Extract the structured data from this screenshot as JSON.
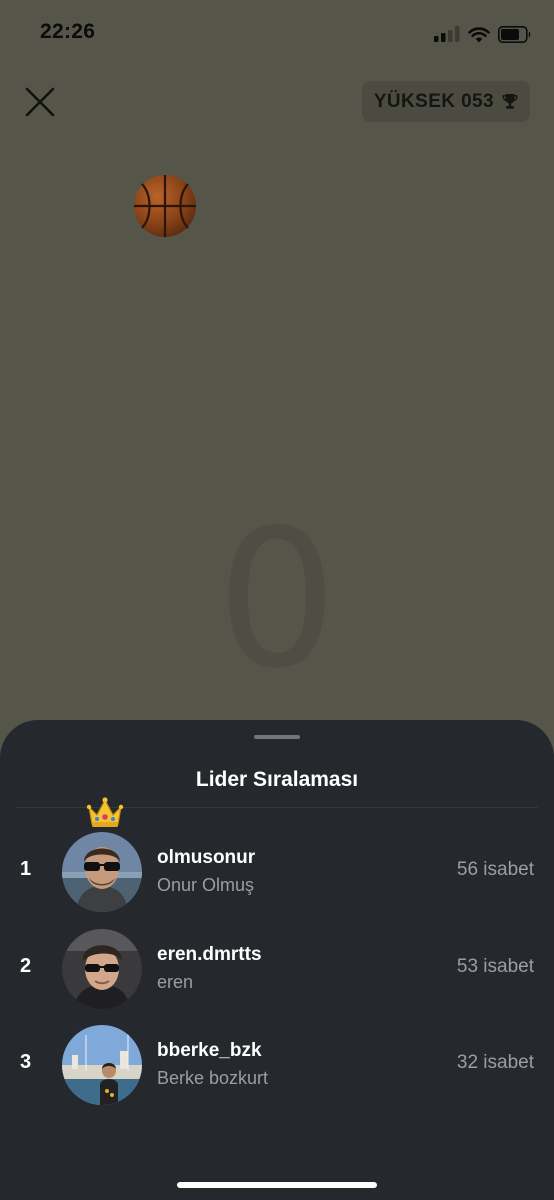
{
  "status_bar": {
    "time": "22:26"
  },
  "header": {
    "close_icon": "close-icon",
    "high_score_label": "YÜKSEK 053",
    "trophy_icon": "trophy-icon"
  },
  "game": {
    "ball_icon": "basketball-icon",
    "current_score": "0"
  },
  "leaderboard": {
    "title": "Lider Sıralaması",
    "entries": [
      {
        "rank": "1",
        "username": "olmusonur",
        "name": "Onur Olmuş",
        "score": "56 isabet",
        "crown": true
      },
      {
        "rank": "2",
        "username": "eren.dmrtts",
        "name": "eren",
        "score": "53 isabet"
      },
      {
        "rank": "3",
        "username": "bberke_bzk",
        "name": "Berke bozkurt",
        "score": "32 isabet"
      }
    ]
  }
}
